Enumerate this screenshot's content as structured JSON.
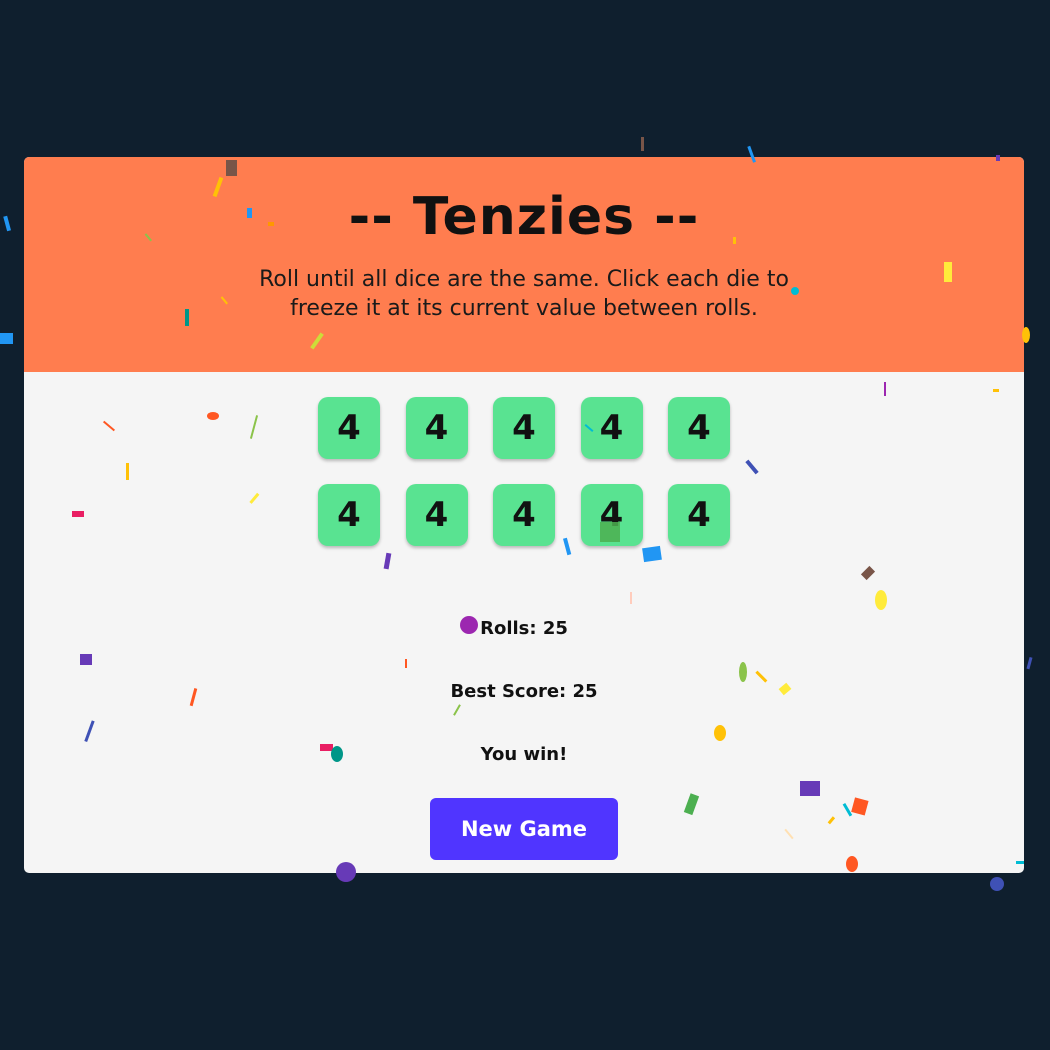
{
  "header": {
    "title": "-- Tenzies --",
    "instructions": "Roll until all dice are the same. Click each die to freeze it at its current value between rolls."
  },
  "dice": [
    "4",
    "4",
    "4",
    "4",
    "4",
    "4",
    "4",
    "4",
    "4",
    "4"
  ],
  "stats": {
    "rolls": "Rolls: 25",
    "best_score": "Best Score: 25",
    "status": "You win!"
  },
  "button": {
    "label": "New Game"
  },
  "colors": {
    "background": "#0f1f2e",
    "header": "#ff7d4f",
    "die_held": "#59e391",
    "button": "#5035ff"
  }
}
